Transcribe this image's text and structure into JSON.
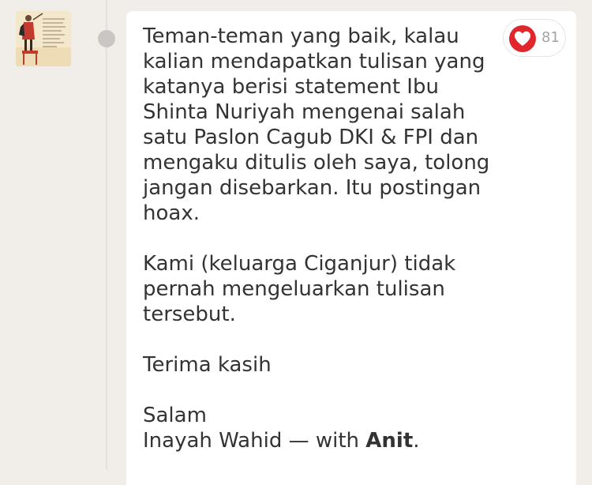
{
  "post": {
    "paragraphs": [
      "Teman-teman yang baik, kalau kalian mendapatkan tulisan yang katanya berisi statement Ibu Shinta Nuriyah mengenai salah satu Paslon Cagub DKI & FPI dan mengaku ditulis oleh saya, tolong jangan disebarkan. Itu postingan hoax.",
      "Kami (keluarga Ciganjur) tidak pernah mengeluarkan  tulisan tersebut.",
      "Terima kasih"
    ],
    "closing": "Salam",
    "signature_prefix": "Inayah Wahid — with ",
    "tagged_name": "Anit",
    "signature_suffix": "."
  },
  "like": {
    "count": "81",
    "icon": "heart-icon",
    "color": "#e0272c"
  },
  "avatar": {
    "icon": "profile-illustration"
  }
}
